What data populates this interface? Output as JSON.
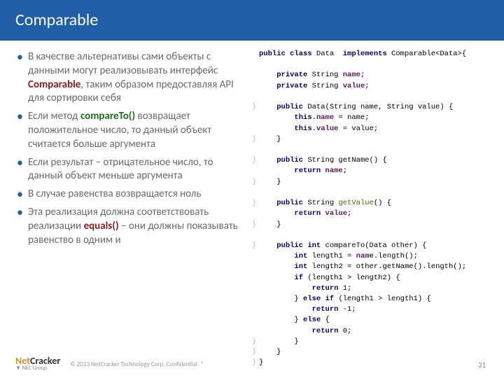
{
  "header": {
    "title": "Comparable"
  },
  "bullets": [
    {
      "pre": "В качестве альтернативы сами объекты с данными  могут реализовывать интерфейс ",
      "hl": "Comparable",
      "hlClass": "hl1",
      "post": ", таким образом предоставляя API для сортировки себя"
    },
    {
      "pre": "Если метод ",
      "hl": "compareTo()",
      "hlClass": "hl2",
      "post": " возвращает положительное число, то данный объект считается больше аргумента"
    },
    {
      "pre": "Если результат – отрицательное число, то данный объект меньше аргумента"
    },
    {
      "pre": "В случае равенства возвращается ноль"
    },
    {
      "pre": "Эта реализация должна соответствовать реализации ",
      "hl": "equals()",
      "hlClass": "hl3",
      "post": " – они должны показывать равенство в одним и"
    }
  ],
  "code": [
    {
      "g": " ",
      "frags": [
        {
          "t": "public class ",
          "c": "kw"
        },
        {
          "t": "Data  "
        },
        {
          "t": "implements ",
          "c": "kw"
        },
        {
          "t": "Comparable<Data>{"
        }
      ]
    },
    {
      "g": " ",
      "frags": []
    },
    {
      "g": " ",
      "frags": [
        {
          "t": "    "
        },
        {
          "t": "private ",
          "c": "kw"
        },
        {
          "t": "String "
        },
        {
          "t": "name",
          "c": "fld"
        },
        {
          "t": ";"
        }
      ]
    },
    {
      "g": " ",
      "frags": [
        {
          "t": "    "
        },
        {
          "t": "private ",
          "c": "kw"
        },
        {
          "t": "String "
        },
        {
          "t": "value",
          "c": "fld"
        },
        {
          "t": ";"
        }
      ]
    },
    {
      "g": " ",
      "frags": []
    },
    {
      "g": "}",
      "frags": [
        {
          "t": "    "
        },
        {
          "t": "public ",
          "c": "kw"
        },
        {
          "t": "Data(String name, String value) {"
        }
      ]
    },
    {
      "g": " ",
      "frags": [
        {
          "t": "        "
        },
        {
          "t": "this",
          "c": "kw"
        },
        {
          "t": "."
        },
        {
          "t": "name",
          "c": "fld"
        },
        {
          "t": " = name;"
        }
      ]
    },
    {
      "g": " ",
      "frags": [
        {
          "t": "        "
        },
        {
          "t": "this",
          "c": "kw"
        },
        {
          "t": "."
        },
        {
          "t": "value",
          "c": "fld"
        },
        {
          "t": " = value;"
        }
      ]
    },
    {
      "g": "}",
      "frags": [
        {
          "t": "    }"
        }
      ]
    },
    {
      "g": " ",
      "frags": []
    },
    {
      "g": "}",
      "frags": [
        {
          "t": "    "
        },
        {
          "t": "public ",
          "c": "kw"
        },
        {
          "t": "String getName() {"
        }
      ]
    },
    {
      "g": " ",
      "frags": [
        {
          "t": "        "
        },
        {
          "t": "return ",
          "c": "kw"
        },
        {
          "t": "name",
          "c": "fld"
        },
        {
          "t": ";"
        }
      ]
    },
    {
      "g": "}",
      "frags": [
        {
          "t": "    }"
        }
      ]
    },
    {
      "g": " ",
      "frags": []
    },
    {
      "g": "}",
      "frags": [
        {
          "t": "    "
        },
        {
          "t": "public ",
          "c": "kw"
        },
        {
          "t": "String "
        },
        {
          "t": "getValue",
          "c": "fn"
        },
        {
          "t": "() {"
        }
      ]
    },
    {
      "g": " ",
      "frags": [
        {
          "t": "        "
        },
        {
          "t": "return ",
          "c": "kw"
        },
        {
          "t": "value",
          "c": "fld"
        },
        {
          "t": ";"
        }
      ]
    },
    {
      "g": "}",
      "frags": [
        {
          "t": "    }"
        }
      ]
    },
    {
      "g": " ",
      "frags": []
    },
    {
      "g": "}",
      "frags": [
        {
          "t": "    "
        },
        {
          "t": "public int ",
          "c": "kw"
        },
        {
          "t": "compareTo(Data other) {"
        }
      ]
    },
    {
      "g": " ",
      "frags": [
        {
          "t": "        "
        },
        {
          "t": "int ",
          "c": "kw"
        },
        {
          "t": "length1 = "
        },
        {
          "t": "name",
          "c": "fld"
        },
        {
          "t": ".length();"
        }
      ]
    },
    {
      "g": " ",
      "frags": [
        {
          "t": "        "
        },
        {
          "t": "int ",
          "c": "kw"
        },
        {
          "t": "length2 = other.getName().length();"
        }
      ]
    },
    {
      "g": " ",
      "frags": [
        {
          "t": "        "
        },
        {
          "t": "if ",
          "c": "kw"
        },
        {
          "t": "(length1 > length2) {"
        }
      ]
    },
    {
      "g": " ",
      "frags": [
        {
          "t": "            "
        },
        {
          "t": "return ",
          "c": "kw"
        },
        {
          "t": "1;"
        }
      ]
    },
    {
      "g": " ",
      "frags": [
        {
          "t": "        } "
        },
        {
          "t": "else if ",
          "c": "kw"
        },
        {
          "t": "(length1 > length1) {"
        }
      ]
    },
    {
      "g": " ",
      "frags": [
        {
          "t": "            "
        },
        {
          "t": "return ",
          "c": "kw"
        },
        {
          "t": "-1;"
        }
      ]
    },
    {
      "g": " ",
      "frags": [
        {
          "t": "        } "
        },
        {
          "t": "else ",
          "c": "kw"
        },
        {
          "t": "{"
        }
      ]
    },
    {
      "g": " ",
      "frags": [
        {
          "t": "            "
        },
        {
          "t": "return ",
          "c": "kw"
        },
        {
          "t": "0;"
        }
      ]
    },
    {
      "g": "}",
      "frags": [
        {
          "t": "        }"
        }
      ]
    },
    {
      "g": "}",
      "frags": [
        {
          "t": "    }"
        }
      ]
    },
    {
      "g": "}",
      "frags": [
        {
          "t": "}"
        }
      ]
    }
  ],
  "footer": {
    "logo_net": "Net",
    "logo_crack": "Cracker",
    "logo_sub": "▼ NEC Group",
    "copyright": "© 2013 NetCracker Technology Corp. Confidential.     *",
    "page": "31"
  }
}
